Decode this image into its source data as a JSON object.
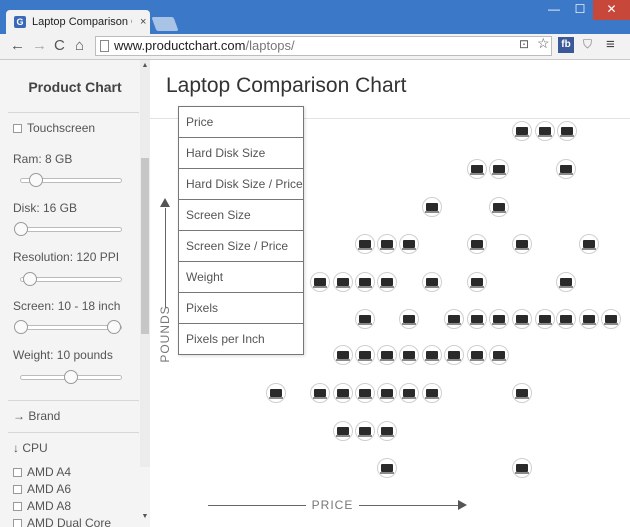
{
  "browser": {
    "tab_title": "Laptop Comparison Char",
    "tab_close": "×",
    "favicon": "G",
    "window_min": "—",
    "window_max": "☐",
    "window_close": "✕",
    "url_domain": "www.productchart.com",
    "url_path": "/laptops/",
    "nav_back": "←",
    "nav_forward": "→",
    "nav_reload": "C",
    "nav_home": "⌂",
    "translate_icon": "⊡",
    "star_icon": "☆",
    "fb_label": "fb",
    "shield_icon": "⛉",
    "menu_icon": "≡"
  },
  "sidebar": {
    "title": "Product Chart",
    "touchscreen": "Touchscreen",
    "ram": {
      "label": "Ram: 8 GB",
      "value": 0.15
    },
    "disk": {
      "label": "Disk: 16 GB",
      "value": 0.0
    },
    "resolution": {
      "label": "Resolution: 120 PPI",
      "value": 0.09
    },
    "screen": {
      "label": "Screen: 10 - 18 inch",
      "min": 0.0,
      "max": 0.93
    },
    "weight": {
      "label": "Weight: 10 pounds",
      "value": 0.5
    },
    "brand": "→ Brand",
    "cpu": "↓ CPU",
    "cpu_options": [
      "AMD A4",
      "AMD A6",
      "AMD A8",
      "AMD Dual Core"
    ],
    "scroll_up": "▲",
    "scroll_down": "▼"
  },
  "main": {
    "title": "Laptop Comparison Chart",
    "y_axis_label": "POUNDS",
    "x_axis_label": "PRICE",
    "y_axis_options": [
      "Price",
      "Hard Disk Size",
      "Hard Disk Size / Price",
      "Screen Size",
      "Screen Size / Price",
      "Weight",
      "Pixels",
      "Pixels per Inch"
    ]
  }
}
